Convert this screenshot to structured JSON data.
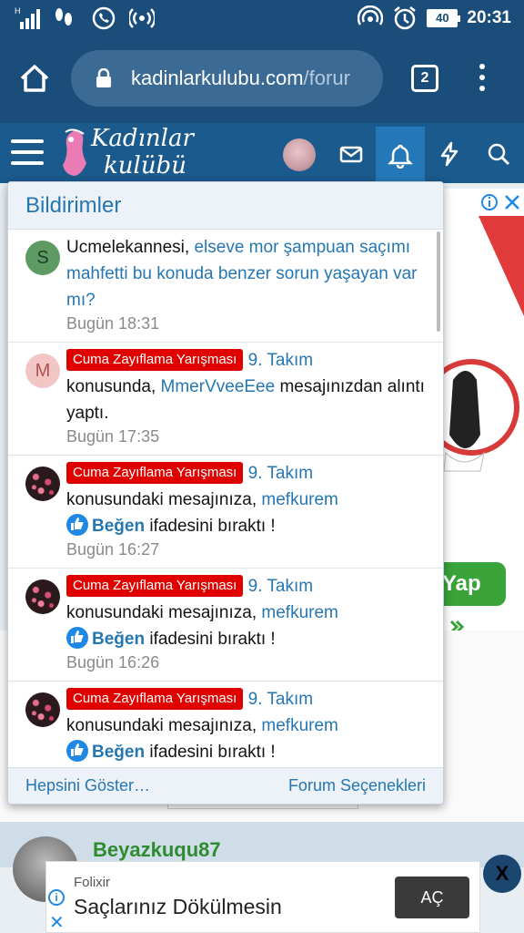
{
  "status_bar": {
    "network": "H",
    "battery": "40",
    "time": "20:31"
  },
  "browser": {
    "url_host": "kadinlarkulubu.com",
    "url_path": "/forur",
    "tab_count": "2"
  },
  "site": {
    "logo_line1": "Kadınlar",
    "logo_line2": "kulübü"
  },
  "notifications_popup": {
    "title": "Bildirimler",
    "items": [
      {
        "avatar_letter": "S",
        "user": "Ucmelekannesi",
        "thread": "elseve mor şampuan saçımı mahfetti bu konuda benzer sorun yaşayan var mı?",
        "time": "Bugün 18:31"
      },
      {
        "avatar_letter": "M",
        "tag": "Cuma Zayıflama Yarışması",
        "thread": "9. Takım",
        "text_before": "konusunda, ",
        "user": "MmerVveeEee",
        "text_after": " mesajınızdan alıntı yaptı.",
        "time": "Bugün 17:35"
      },
      {
        "tag": "Cuma Zayıflama Yarışması",
        "thread": "9. Takım",
        "text_before": "konusundaki mesajınıza, ",
        "user": "mefkurem",
        "reaction": "Beğen",
        "text_after": " ifadesini bıraktı !",
        "time": "Bugün 16:27"
      },
      {
        "tag": "Cuma Zayıflama Yarışması",
        "thread": "9. Takım",
        "text_before": "konusundaki mesajınıza, ",
        "user": "mefkurem",
        "reaction": "Beğen",
        "text_after": " ifadesini bıraktı !",
        "time": "Bugün 16:26"
      },
      {
        "tag": "Cuma Zayıflama Yarışması",
        "thread": "9. Takım",
        "text_before": "konusundaki mesajınıza, ",
        "user": "mefkurem",
        "reaction": "Beğen",
        "text_after": " ifadesini bıraktı !"
      }
    ],
    "footer_left": "Hepsini Göster…",
    "footer_right": "Forum Seçenekleri"
  },
  "background_page": {
    "cta_partial": "Yap",
    "username": "Beyazkuqu87"
  },
  "bottom_ad": {
    "brand": "Folixir",
    "headline": "Saçlarınız Dökülmesin",
    "cta": "AÇ",
    "close": "X"
  },
  "colors": {
    "status_bar": "#1a4d7a",
    "header": "#1b5a8c",
    "link": "#2577b1",
    "tag": "#e00000"
  }
}
